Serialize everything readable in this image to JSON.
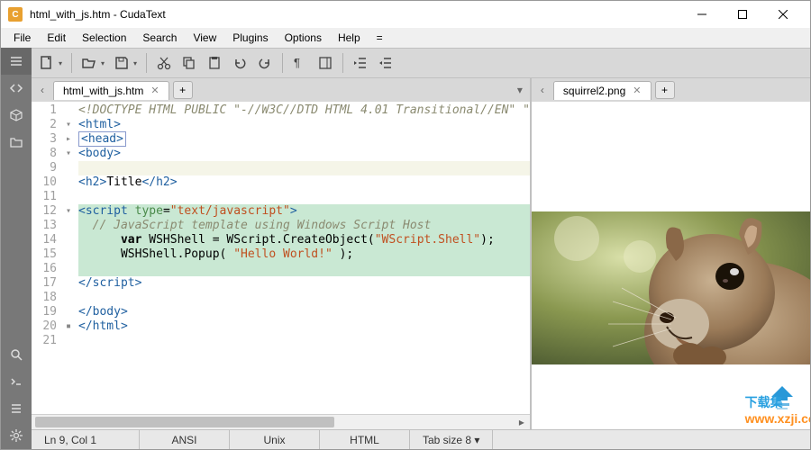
{
  "window": {
    "title": "html_with_js.htm - CudaText",
    "app_icon_letter": "C"
  },
  "menu": [
    "File",
    "Edit",
    "Selection",
    "Search",
    "View",
    "Plugins",
    "Options",
    "Help",
    "="
  ],
  "sidebar_top": [
    "menu",
    "code",
    "box",
    "folder"
  ],
  "sidebar_bottom": [
    "search",
    "terminal",
    "list",
    "settings"
  ],
  "editor": {
    "tab": "html_with_js.htm",
    "lines": [
      {
        "n": 1,
        "fold": "",
        "kind": "comment",
        "text": "<!DOCTYPE HTML PUBLIC \"-//W3C//DTD HTML 4.01 Transitional//EN\" \""
      },
      {
        "n": 2,
        "fold": "▾",
        "kind": "tag",
        "open": "<",
        "name": "html",
        "close": ">"
      },
      {
        "n": 3,
        "fold": "▸",
        "kind": "folded",
        "open": "<",
        "name": "head",
        "close": ">"
      },
      {
        "n": 8,
        "fold": "▾",
        "kind": "tag",
        "open": "<",
        "name": "body",
        "close": ">"
      },
      {
        "n": 9,
        "fold": "",
        "kind": "current",
        "text": ""
      },
      {
        "n": 10,
        "fold": "",
        "kind": "h2",
        "open": "<",
        "name": "h2",
        "close": ">",
        "inner": "Title",
        "open2": "</",
        "name2": "h2",
        "close2": ">"
      },
      {
        "n": 11,
        "fold": "",
        "kind": "blank",
        "text": ""
      },
      {
        "n": 12,
        "fold": "▾",
        "kind": "script-open",
        "open": "<",
        "name": "script",
        "sp": " ",
        "attr": "type",
        "eq": "=",
        "val": "\"text/javascript\"",
        "close": ">"
      },
      {
        "n": 13,
        "fold": "",
        "kind": "js-comment",
        "text": "  // JavaScript template using Windows Script Host"
      },
      {
        "n": 14,
        "fold": "",
        "kind": "js1",
        "indent": "      ",
        "kw": "var",
        "rest1": " WSHShell = WScript.CreateObject(",
        "str": "\"WScript.Shell\"",
        "rest2": ");"
      },
      {
        "n": 15,
        "fold": "",
        "kind": "js2",
        "indent": "      ",
        "rest1": "WSHShell.Popup( ",
        "str": "\"Hello World!\"",
        "rest2": " );"
      },
      {
        "n": 16,
        "fold": "",
        "kind": "sel-blank",
        "text": ""
      },
      {
        "n": 17,
        "fold": "",
        "kind": "close-tag",
        "open": "</",
        "name": "script",
        "close": ">"
      },
      {
        "n": 18,
        "fold": "",
        "kind": "blank",
        "text": ""
      },
      {
        "n": 19,
        "fold": "",
        "kind": "close-tag",
        "open": "</",
        "name": "body",
        "close": ">"
      },
      {
        "n": 20,
        "fold": "▪",
        "kind": "close-tag",
        "open": "</",
        "name": "html",
        "close": ">"
      },
      {
        "n": 21,
        "fold": "",
        "kind": "blank",
        "text": ""
      }
    ]
  },
  "image": {
    "tab": "squirrel2.png"
  },
  "watermark": {
    "a": "下载集",
    "b": "www.xzji.com"
  },
  "status": {
    "pos": "Ln 9, Col 1",
    "enc": "ANSI",
    "eol": "Unix",
    "lexer": "HTML",
    "tab": "Tab size 8",
    "arrow": "▾"
  }
}
